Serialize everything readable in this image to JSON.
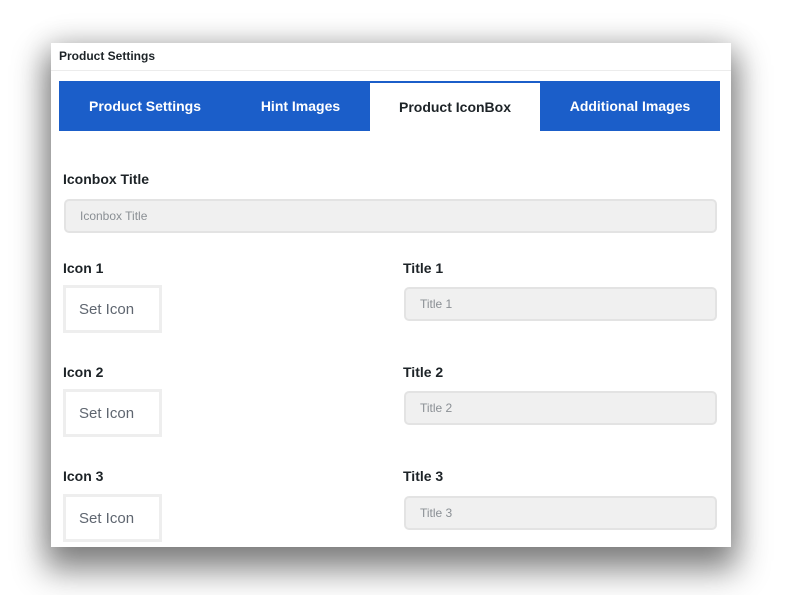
{
  "panel": {
    "title": "Product Settings"
  },
  "tabs": [
    {
      "label": "Product Settings",
      "active": false
    },
    {
      "label": "Hint Images",
      "active": false
    },
    {
      "label": "Product IconBox",
      "active": true
    },
    {
      "label": "Additional Images",
      "active": false
    }
  ],
  "colors": {
    "tab_bar": "#1b5ec9",
    "active_tab": "#ffffff"
  },
  "form": {
    "iconbox_title": {
      "label": "Iconbox Title",
      "value": "",
      "placeholder": "Iconbox Title"
    },
    "rows": [
      {
        "icon_label": "Icon 1",
        "icon_button": "Set Icon",
        "title_label": "Title 1",
        "title_value": "",
        "title_placeholder": "Title 1"
      },
      {
        "icon_label": "Icon 2",
        "icon_button": "Set Icon",
        "title_label": "Title 2",
        "title_value": "",
        "title_placeholder": "Title 2"
      },
      {
        "icon_label": "Icon 3",
        "icon_button": "Set Icon",
        "title_label": "Title 3",
        "title_value": "",
        "title_placeholder": "Title 3"
      }
    ]
  }
}
